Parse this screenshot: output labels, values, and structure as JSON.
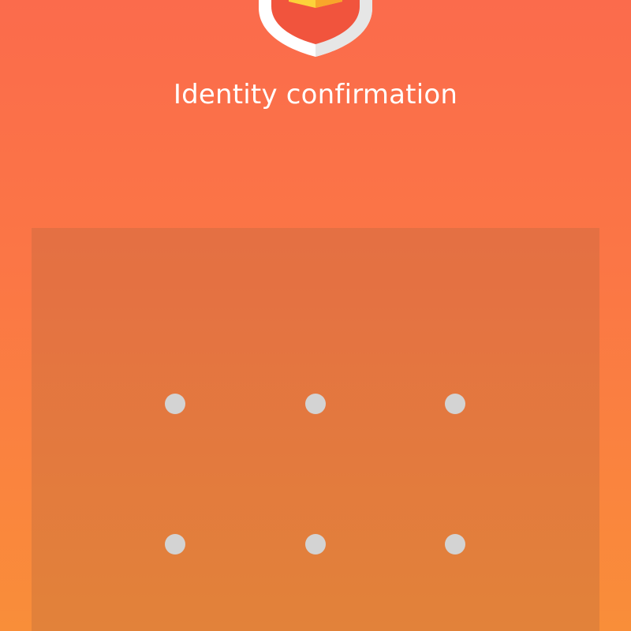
{
  "header": {
    "logo_icon": "shield-lock-icon",
    "title": "Identity confirmation"
  },
  "pattern_lock": {
    "rows_visible": 2,
    "columns": 3,
    "dot_color": "#d3d3d3",
    "panel_color": "#e0703f"
  },
  "colors": {
    "background_top": "#fb6b4c",
    "background_bottom": "#f98e39",
    "text": "#ffffff",
    "shield_outer": "#ffffff",
    "shield_inner_shade": "#e6e6e6",
    "shield_badge": "#fbb52a"
  }
}
